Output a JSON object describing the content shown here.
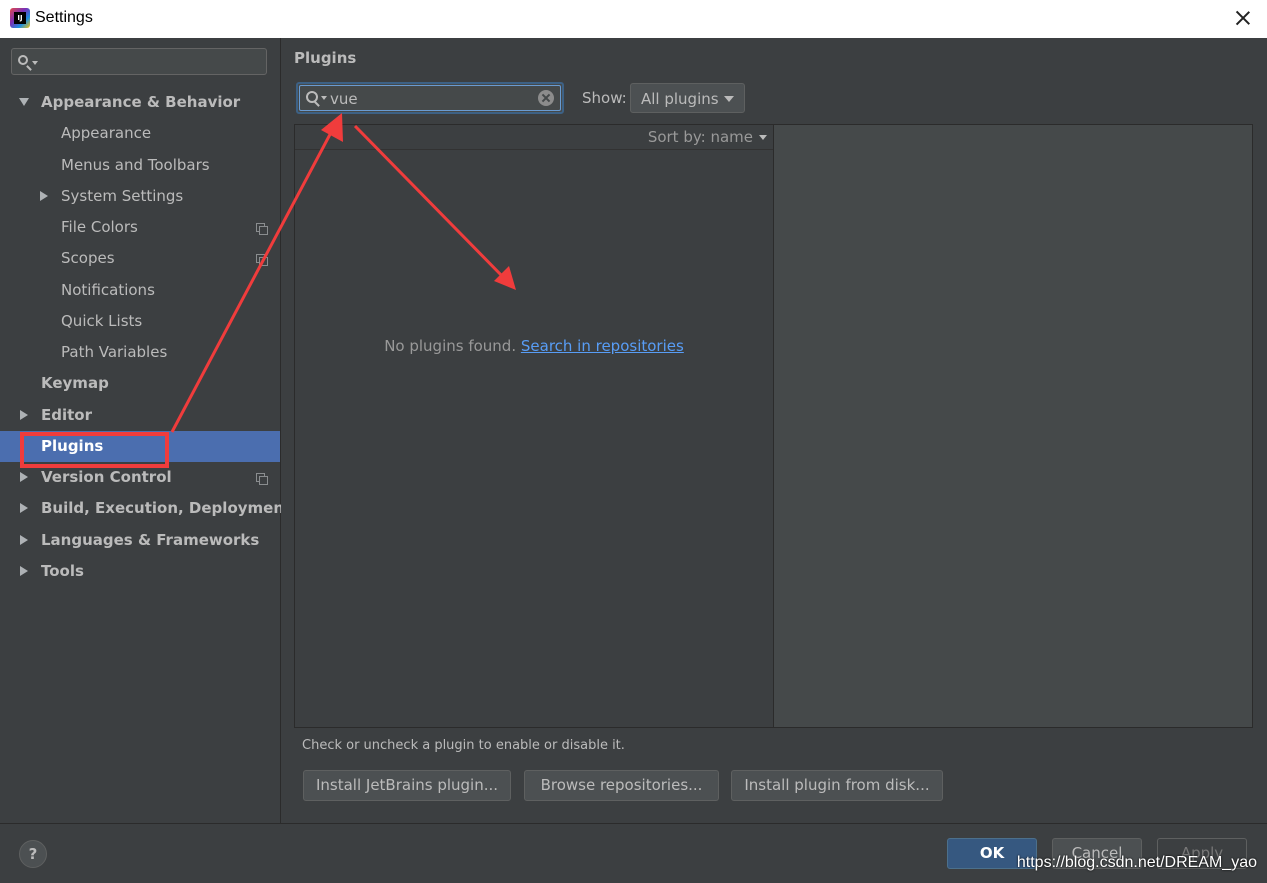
{
  "window": {
    "title": "Settings"
  },
  "sidebar": {
    "search_value": "",
    "items": [
      {
        "label": "Appearance & Behavior"
      },
      {
        "label": "Appearance"
      },
      {
        "label": "Menus and Toolbars"
      },
      {
        "label": "System Settings"
      },
      {
        "label": "File Colors"
      },
      {
        "label": "Scopes"
      },
      {
        "label": "Notifications"
      },
      {
        "label": "Quick Lists"
      },
      {
        "label": "Path Variables"
      },
      {
        "label": "Keymap"
      },
      {
        "label": "Editor"
      },
      {
        "label": "Plugins"
      },
      {
        "label": "Version Control"
      },
      {
        "label": "Build, Execution, Deployment"
      },
      {
        "label": "Languages & Frameworks"
      },
      {
        "label": "Tools"
      }
    ],
    "selected": "Plugins"
  },
  "plugins": {
    "title": "Plugins",
    "search_value": "vue",
    "show_label": "Show:",
    "show_value": "All plugins",
    "sort_label": "Sort by: name",
    "empty_message": "No plugins found.",
    "empty_link": "Search in repositories",
    "hint": "Check or uncheck a plugin to enable or disable it.",
    "buttons": {
      "install_jetbrains": "Install JetBrains plugin...",
      "browse": "Browse repositories...",
      "install_disk": "Install plugin from disk..."
    }
  },
  "footer": {
    "help": "?",
    "ok": "OK",
    "cancel": "Cancel",
    "apply": "Apply",
    "watermark": "https://blog.csdn.net/DREAM_yao"
  },
  "colors": {
    "selection": "#4b6eaf",
    "annotation": "#f03c3c",
    "link": "#589df6"
  },
  "icons": [
    "app-logo-icon",
    "close-icon",
    "search-icon",
    "clear-icon",
    "expand-arrow-icon",
    "collapse-arrow-icon",
    "copy-scope-icon",
    "dropdown-arrow-icon",
    "help-icon"
  ]
}
